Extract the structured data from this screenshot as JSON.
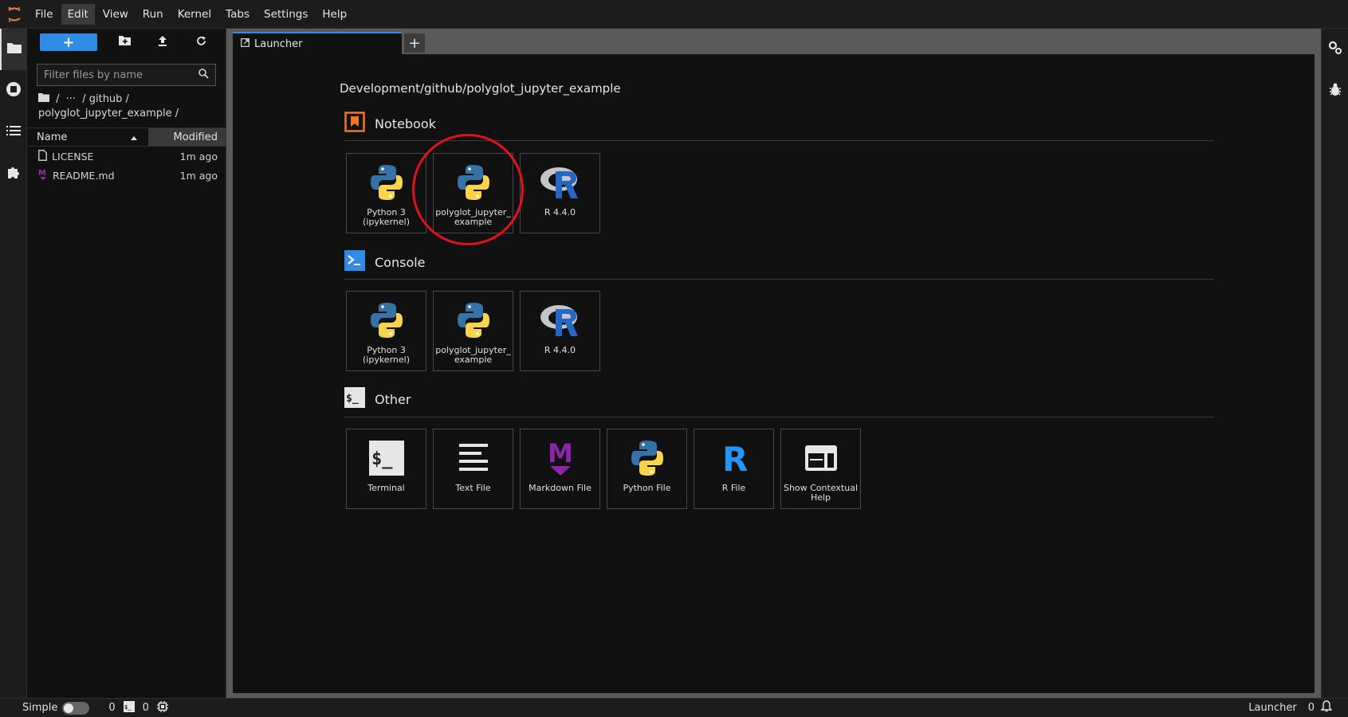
{
  "menu": {
    "items": [
      "File",
      "Edit",
      "View",
      "Run",
      "Kernel",
      "Tabs",
      "Settings",
      "Help"
    ],
    "active": "Edit"
  },
  "filebrowser": {
    "new_label": "+",
    "search_placeholder": "Filter files by name",
    "breadcrumb_root": "/",
    "breadcrumb_ellipsis": "···",
    "breadcrumb_github": "/ github /",
    "breadcrumb_current": "polyglot_jupyter_example /",
    "col_name": "Name",
    "col_modified": "Modified",
    "files": [
      {
        "name": "LICENSE",
        "modified": "1m ago",
        "icon": "file-icon"
      },
      {
        "name": "README.md",
        "modified": "1m ago",
        "icon": "markdown-icon"
      }
    ]
  },
  "tabs": {
    "launcher_label": "Launcher",
    "add_label": "+"
  },
  "launcher": {
    "path": "Development/github/polyglot_jupyter_example",
    "notebook_title": "Notebook",
    "console_title": "Console",
    "other_title": "Other",
    "notebook_cards": [
      {
        "label": "Python 3 (ipykernel)",
        "icon": "python-icon"
      },
      {
        "label": "polyglot_jupyter_ example",
        "icon": "python-icon"
      },
      {
        "label": "R 4.4.0",
        "icon": "r-logo-icon"
      }
    ],
    "console_cards": [
      {
        "label": "Python 3 (ipykernel)",
        "icon": "python-icon"
      },
      {
        "label": "polyglot_jupyter_ example",
        "icon": "python-icon"
      },
      {
        "label": "R 4.4.0",
        "icon": "r-logo-icon"
      }
    ],
    "other_cards": [
      {
        "label": "Terminal",
        "icon": "terminal-icon"
      },
      {
        "label": "Text File",
        "icon": "text-file-icon"
      },
      {
        "label": "Markdown File",
        "icon": "markdown-icon"
      },
      {
        "label": "Python File",
        "icon": "python-icon"
      },
      {
        "label": "R File",
        "icon": "r-file-icon"
      },
      {
        "label": "Show Contextual Help",
        "icon": "contextual-help-icon"
      }
    ]
  },
  "statusbar": {
    "mode_label": "Simple",
    "kernels_count": "0",
    "terminals_count": "0",
    "right_label": "Launcher",
    "notifications_count": "0"
  },
  "colors": {
    "accent": "#2f8be6",
    "highlight_circle": "#e0121c",
    "notebook_icon": "#f37626",
    "console_icon": "#2f8be6"
  }
}
